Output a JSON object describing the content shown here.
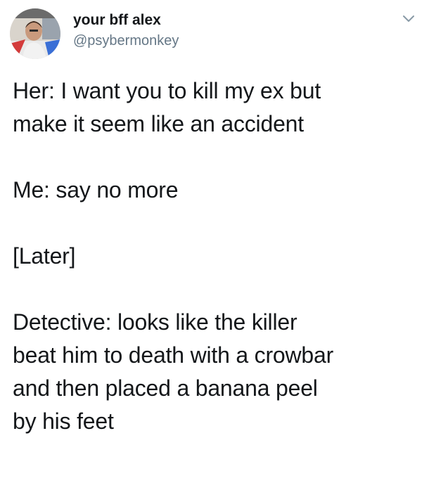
{
  "tweet": {
    "author": {
      "display_name": "your bff alex",
      "handle": "@psybermonkey",
      "avatar_icon": "profile-photo"
    },
    "menu_icon": "chevron-down-icon",
    "lines": {
      "line1": "Her: I want you to kill my ex but",
      "line2": "make it seem like an accident",
      "line3": "Me: say no more",
      "line4": "[Later]",
      "line5": "Detective: looks like the killer",
      "line6": "beat him to death with a crowbar",
      "line7": "and then placed a banana peel",
      "line8": "by his feet"
    }
  },
  "colors": {
    "text": "#14171a",
    "secondary": "#657786",
    "background": "#ffffff"
  }
}
